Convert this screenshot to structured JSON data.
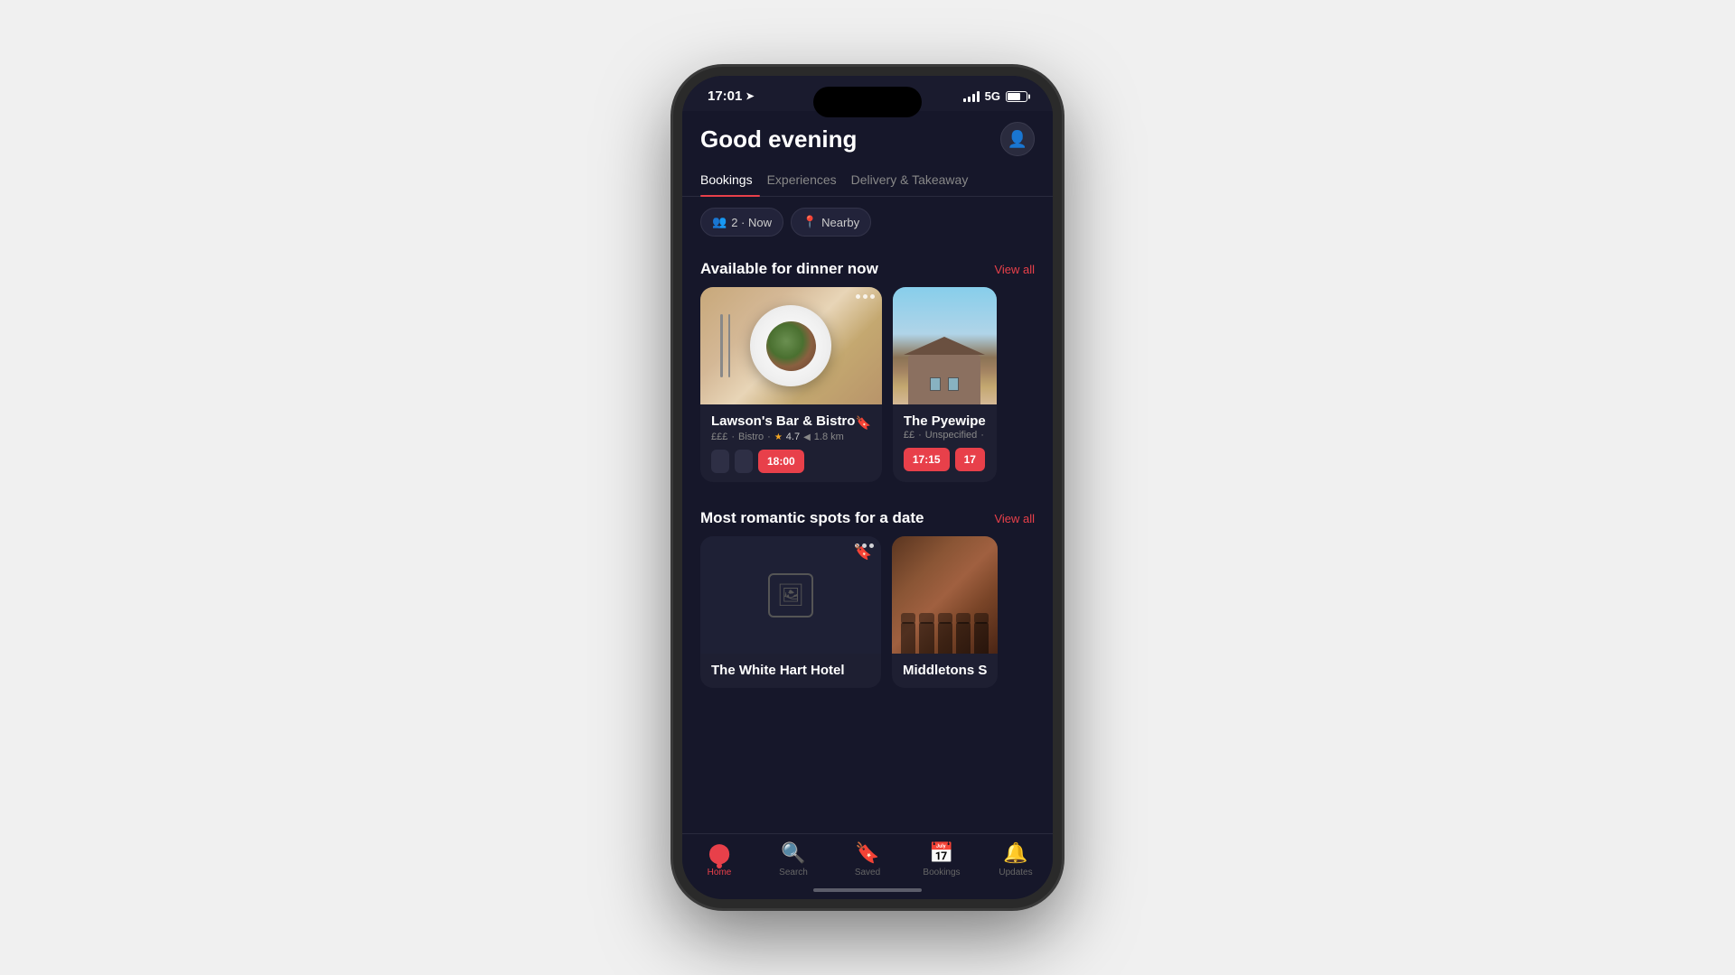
{
  "phone": {
    "status_bar": {
      "time": "17:01",
      "signal_label": "signal",
      "network": "5G"
    },
    "header": {
      "greeting": "Good evening",
      "avatar_label": "Profile"
    },
    "tabs": [
      {
        "label": "Bookings",
        "active": true
      },
      {
        "label": "Experiences",
        "active": false
      },
      {
        "label": "Delivery & Takeaway",
        "active": false
      }
    ],
    "filters": [
      {
        "label": "2 · Now",
        "icon": "👥"
      },
      {
        "label": "Nearby",
        "icon": "📍"
      }
    ],
    "sections": [
      {
        "title": "Available for dinner now",
        "view_all": "View all",
        "cards": [
          {
            "name": "Lawson's Bar & Bistro",
            "price": "£££",
            "category": "Bistro",
            "rating": "4.7",
            "distance": "1.8 km",
            "time_slots": [
              "",
              "",
              "18:00"
            ],
            "bookmarked": false,
            "image_type": "food"
          },
          {
            "name": "The Pyewipe",
            "price": "££",
            "category": "Unspecified",
            "rating": "",
            "distance": "",
            "time_slots": [
              "17:15",
              "17"
            ],
            "bookmarked": false,
            "image_type": "building"
          }
        ]
      },
      {
        "title": "Most romantic spots for a date",
        "view_all": "View all",
        "cards": [
          {
            "name": "The White Hart Hotel",
            "price": "",
            "category": "",
            "rating": "",
            "distance": "",
            "time_slots": [],
            "bookmarked": true,
            "image_type": "placeholder"
          },
          {
            "name": "Middletons S",
            "price": "",
            "category": "",
            "rating": "",
            "distance": "",
            "time_slots": [],
            "bookmarked": false,
            "image_type": "interior"
          }
        ]
      }
    ],
    "bottom_nav": [
      {
        "label": "Home",
        "icon": "home",
        "active": true
      },
      {
        "label": "Search",
        "icon": "search",
        "active": false
      },
      {
        "label": "Saved",
        "icon": "bookmark",
        "active": false
      },
      {
        "label": "Bookings",
        "icon": "calendar",
        "active": false
      },
      {
        "label": "Updates",
        "icon": "bell",
        "active": false
      }
    ]
  }
}
